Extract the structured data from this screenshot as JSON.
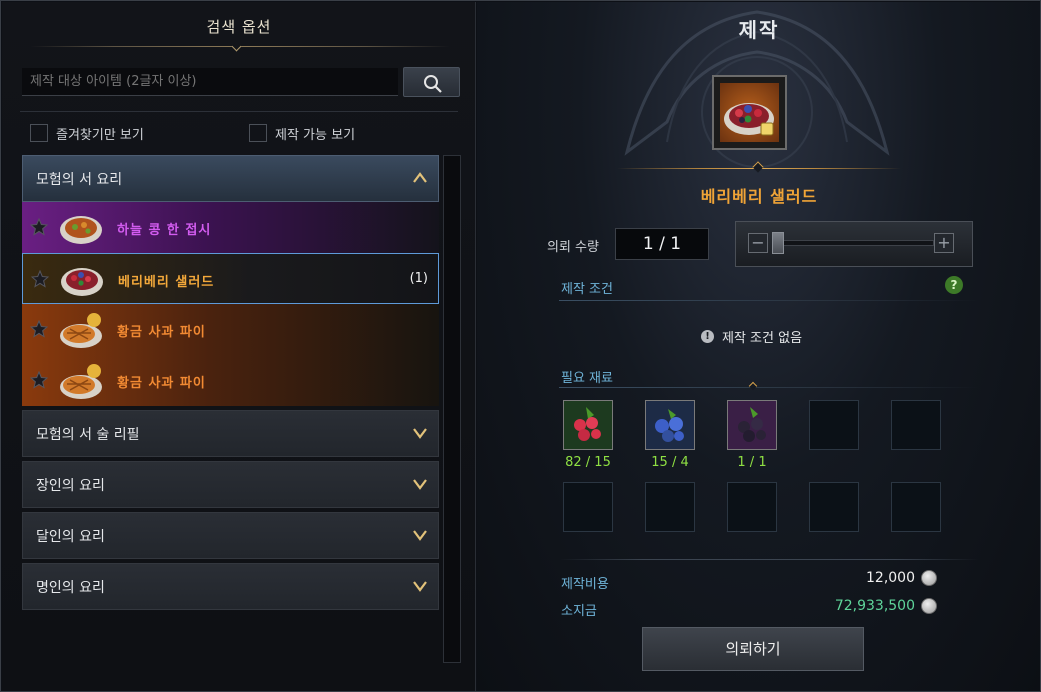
{
  "left_panel": {
    "title": "검색 옵션",
    "search_placeholder": "제작 대상 아이템 (2글자 이상)",
    "favorites_label": "즐겨찾기만 보기",
    "craftable_label": "제작 가능 보기"
  },
  "categories": [
    {
      "label": "모험의 서 요리",
      "expanded": true
    },
    {
      "label": "모험의 서 술 리필",
      "expanded": false
    },
    {
      "label": "장인의 요리",
      "expanded": false
    },
    {
      "label": "달인의 요리",
      "expanded": false
    },
    {
      "label": "명인의 요리",
      "expanded": false
    }
  ],
  "items": [
    {
      "name": "하늘 콩 한 접시",
      "grade": "purple",
      "count": ""
    },
    {
      "name": "베리베리 샐러드",
      "grade": "selected",
      "count": "(1)"
    },
    {
      "name": "황금 사과 파이",
      "grade": "orange",
      "count": ""
    },
    {
      "name": "황금 사과 파이",
      "grade": "orange",
      "count": ""
    }
  ],
  "right_panel": {
    "title": "제작",
    "item_name": "베리베리 샐러드",
    "quantity_label": "의뢰 수량",
    "quantity_value": "1 / 1",
    "slider_minus": "−",
    "slider_plus": "+",
    "conditions_label": "제작 조건",
    "help_icon_label": "?",
    "no_conditions_text": "제작 조건 없음",
    "materials_label": "필요 재료",
    "materials": [
      {
        "icon": "raspberry-icon",
        "count": "82 / 15"
      },
      {
        "icon": "blueberry-icon",
        "count": "15 / 4"
      },
      {
        "icon": "blackberry-icon",
        "count": "1 / 1"
      }
    ],
    "cost_label": "제작비용",
    "cost_value": "12,000",
    "gold_label": "소지금",
    "gold_value": "72,933,500",
    "request_button": "의뢰하기"
  },
  "colors": {
    "accent_blue": "#6fb4d9",
    "item_orange": "#f0a437",
    "material_green": "#8fe043",
    "gold_green": "#5fd59a"
  }
}
